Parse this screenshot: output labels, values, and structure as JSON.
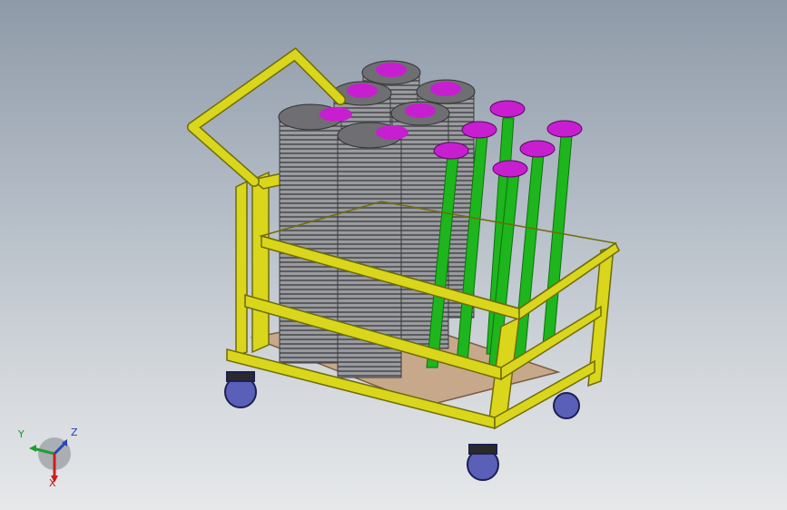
{
  "viewport": {
    "background_top": "#8f9aa8",
    "background_bottom": "#e6e8ea"
  },
  "model": {
    "frame_color": "#d9d61c",
    "frame_edge_color": "#6f6b0a",
    "base_color": "#c8a88a",
    "cap_color": "#c71fd0",
    "cap_rim_color": "#6e6e73",
    "rod_color": "#1db61d",
    "stack_color": "#8a8b8e",
    "wheel_color": "#5a60b8"
  },
  "triad": {
    "axis_labels": {
      "x": "X",
      "y": "Y",
      "z": "Z"
    },
    "colors": {
      "x": "#cc1f1f",
      "y": "#1f9f2f",
      "z": "#2845b8"
    }
  }
}
